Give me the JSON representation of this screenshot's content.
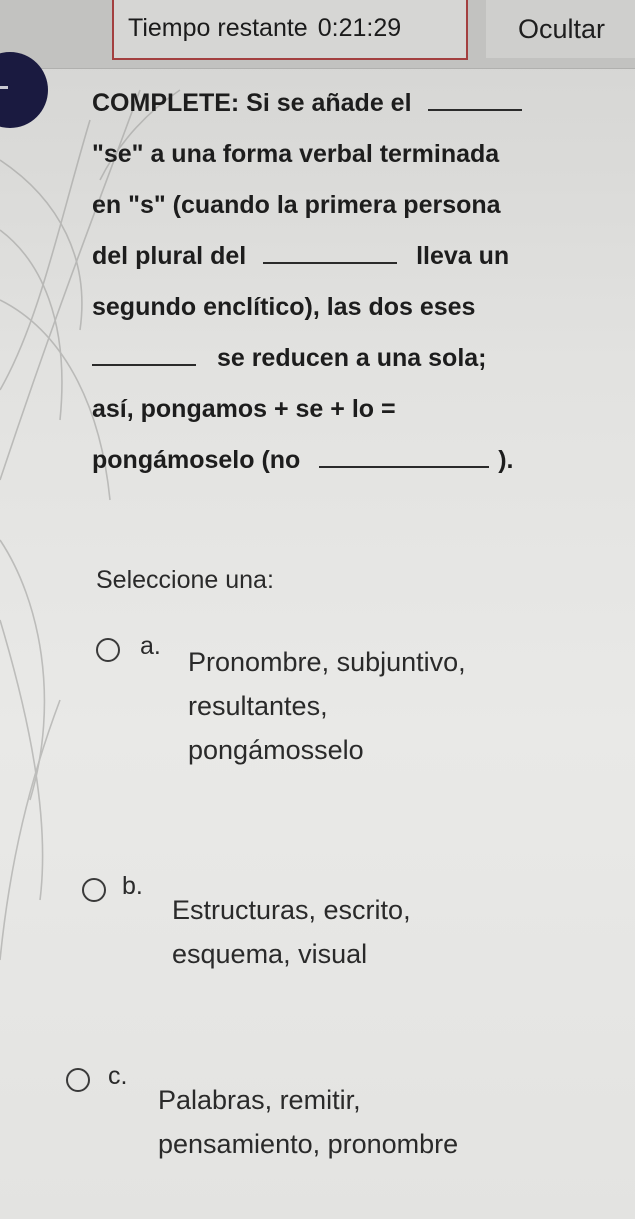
{
  "timer": {
    "label": "Tiempo restante",
    "value": "0:21:29"
  },
  "hide_button": {
    "label": "Ocultar"
  },
  "question": {
    "lines": [
      {
        "text": "COMPLETE: Si se añade el",
        "blank_after": true
      },
      {
        "text": "\"se\" a una forma verbal terminada"
      },
      {
        "text": "en \"s\" (cuando la primera persona"
      },
      {
        "text": "del plural del",
        "blank_mid": true,
        "text_after": "lleva un"
      },
      {
        "text": "segundo enclítico), las dos eses"
      },
      {
        "blank_before": true,
        "text": "se reducen a una sola;"
      },
      {
        "text": "así, pongamos + se + lo ="
      },
      {
        "text": "pongámoselo (no",
        "blank_mid": true,
        "text_after": ")."
      }
    ]
  },
  "prompt": "Seleccione una:",
  "options": [
    {
      "letter": "a.",
      "lines": [
        "Pronombre, subjuntivo,",
        "resultantes,",
        "pongámosselo"
      ]
    },
    {
      "letter": "b.",
      "lines": [
        "Estructuras, escrito,",
        "esquema, visual"
      ]
    },
    {
      "letter": "c.",
      "lines": [
        "Palabras, remitir,",
        "pensamiento, pronombre"
      ]
    }
  ]
}
